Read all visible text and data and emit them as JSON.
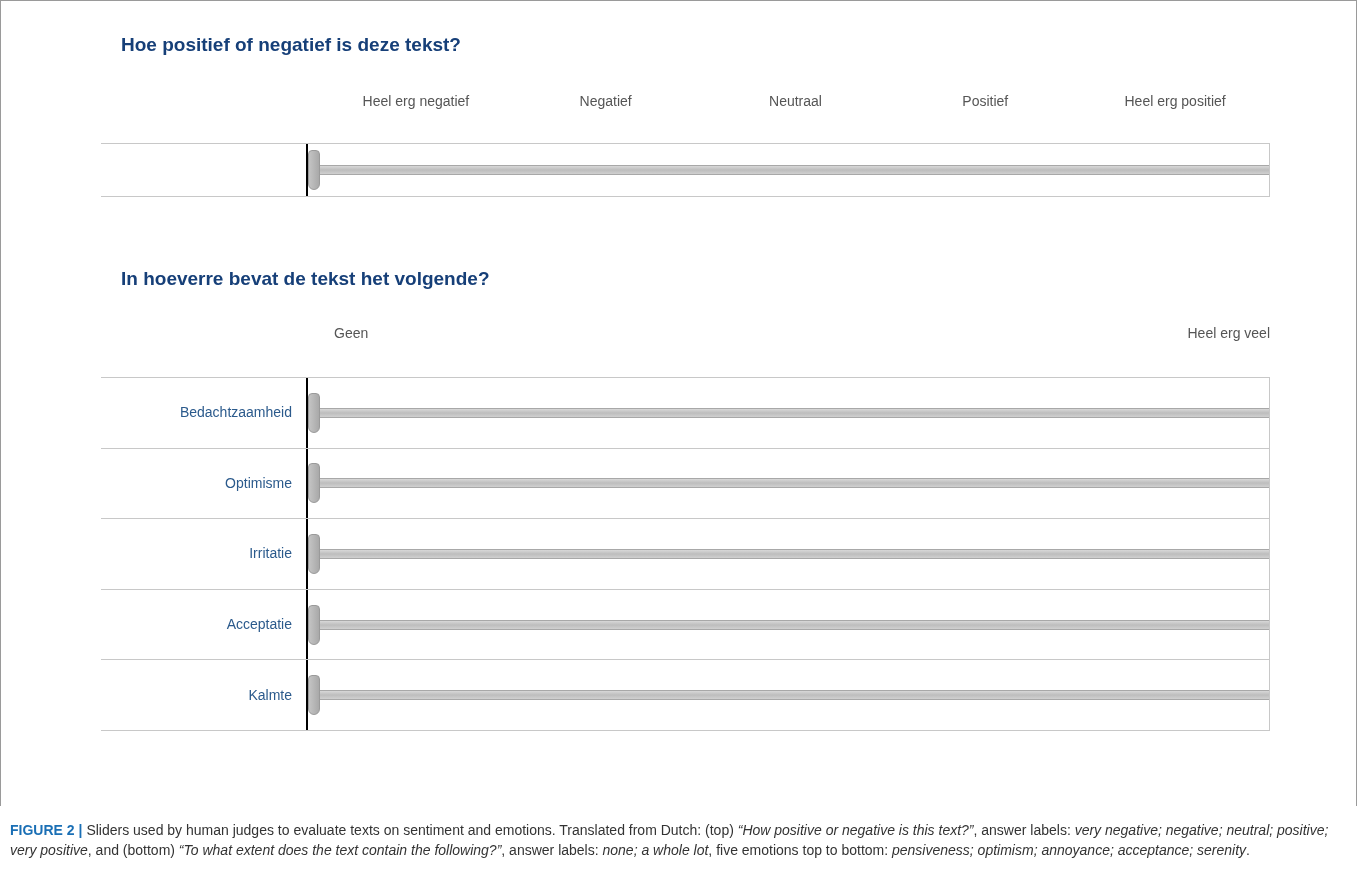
{
  "sentiment": {
    "title": "Hoe positief of negatief is deze tekst?",
    "scale_labels": [
      "Heel erg negatief",
      "Negatief",
      "Neutraal",
      "Positief",
      "Heel erg positief"
    ],
    "sliders": [
      {
        "level": 0
      }
    ]
  },
  "emotions": {
    "title": "In hoeverre bevat de tekst het volgende?",
    "scale_labels": [
      "Geen",
      "Heel erg veel"
    ],
    "sliders": [
      {
        "label": "Bedachtzaamheid",
        "level": 0
      },
      {
        "label": "Optimisme",
        "level": 0
      },
      {
        "label": "Irritatie",
        "level": 0
      },
      {
        "label": "Acceptatie",
        "level": 0
      },
      {
        "label": "Kalmte",
        "level": 0
      }
    ]
  },
  "caption": {
    "label": "FIGURE 2 |",
    "text": "Sliders used by human judges to evaluate texts on sentiment and emotions. Translated from Dutch: (top) *“How positive or negative is this text?”*, answer labels: *very negative; negative; neutral; positive; very positive*, and (bottom) *“To what extent does the text contain the following?”*, answer labels: *none; a whole lot*, five emotions top to bottom: *pensiveness; optimism; annoyance; acceptance; serenity*."
  }
}
